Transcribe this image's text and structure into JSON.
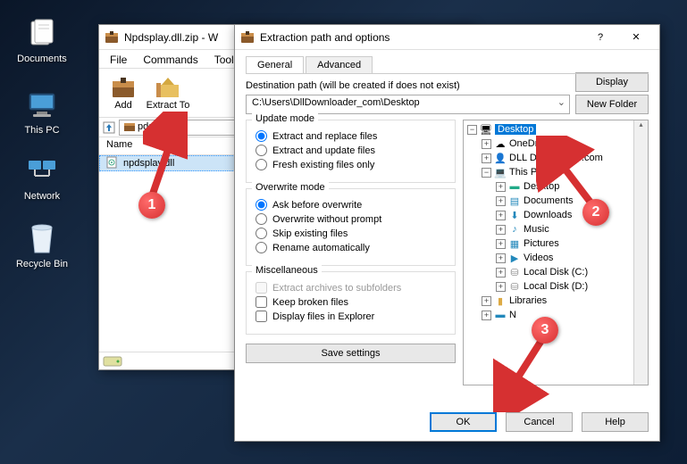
{
  "desktop": {
    "icons": [
      {
        "label": "Documents"
      },
      {
        "label": "This PC"
      },
      {
        "label": "Network"
      },
      {
        "label": "Recycle Bin"
      }
    ]
  },
  "winrar": {
    "title": "Npdsplay.dll.zip - W",
    "menu": [
      "File",
      "Commands",
      "Tools"
    ],
    "toolbar": [
      {
        "label": "Add"
      },
      {
        "label": "Extract To"
      }
    ],
    "address": "pdsplay.c",
    "list_header": "Name",
    "files": [
      {
        "name": "npdsplay.dll",
        "selected": true
      }
    ]
  },
  "dialog": {
    "title": "Extraction path and options",
    "help_btn": "?",
    "close_btn": "✕",
    "tabs": {
      "general": "General",
      "advanced": "Advanced"
    },
    "dest_label": "Destination path (will be created if does not exist)",
    "path": "C:\\Users\\DllDownloader_com\\Desktop",
    "display_btn": "Display",
    "newfolder_btn": "New Folder",
    "update_mode": {
      "label": "Update mode",
      "o1": "Extract and replace files",
      "o2": "Extract and update files",
      "o3": "Fresh existing files only"
    },
    "overwrite_mode": {
      "label": "Overwrite mode",
      "o1": "Ask before overwrite",
      "o2": "Overwrite without prompt",
      "o3": "Skip existing files",
      "o4": "Rename automatically"
    },
    "misc": {
      "label": "Miscellaneous",
      "o1": "Extract archives to subfolders",
      "o2": "Keep broken files",
      "o3": "Display files in Explorer"
    },
    "save_settings": "Save settings",
    "tree": {
      "n0": "Desktop",
      "n1": "OneDri",
      "n2": "DLL Downloader.com",
      "n3": "This PC",
      "n4": "Desktop",
      "n5": "Documents",
      "n6": "Downloads",
      "n7": "Music",
      "n8": "Pictures",
      "n9": "Videos",
      "n10": "Local Disk (C:)",
      "n11": "Local Disk (D:)",
      "n12": "Libraries",
      "n13": "N"
    },
    "ok": "OK",
    "cancel": "Cancel",
    "help": "Help"
  },
  "annotations": {
    "a1": "1",
    "a2": "2",
    "a3": "3"
  }
}
